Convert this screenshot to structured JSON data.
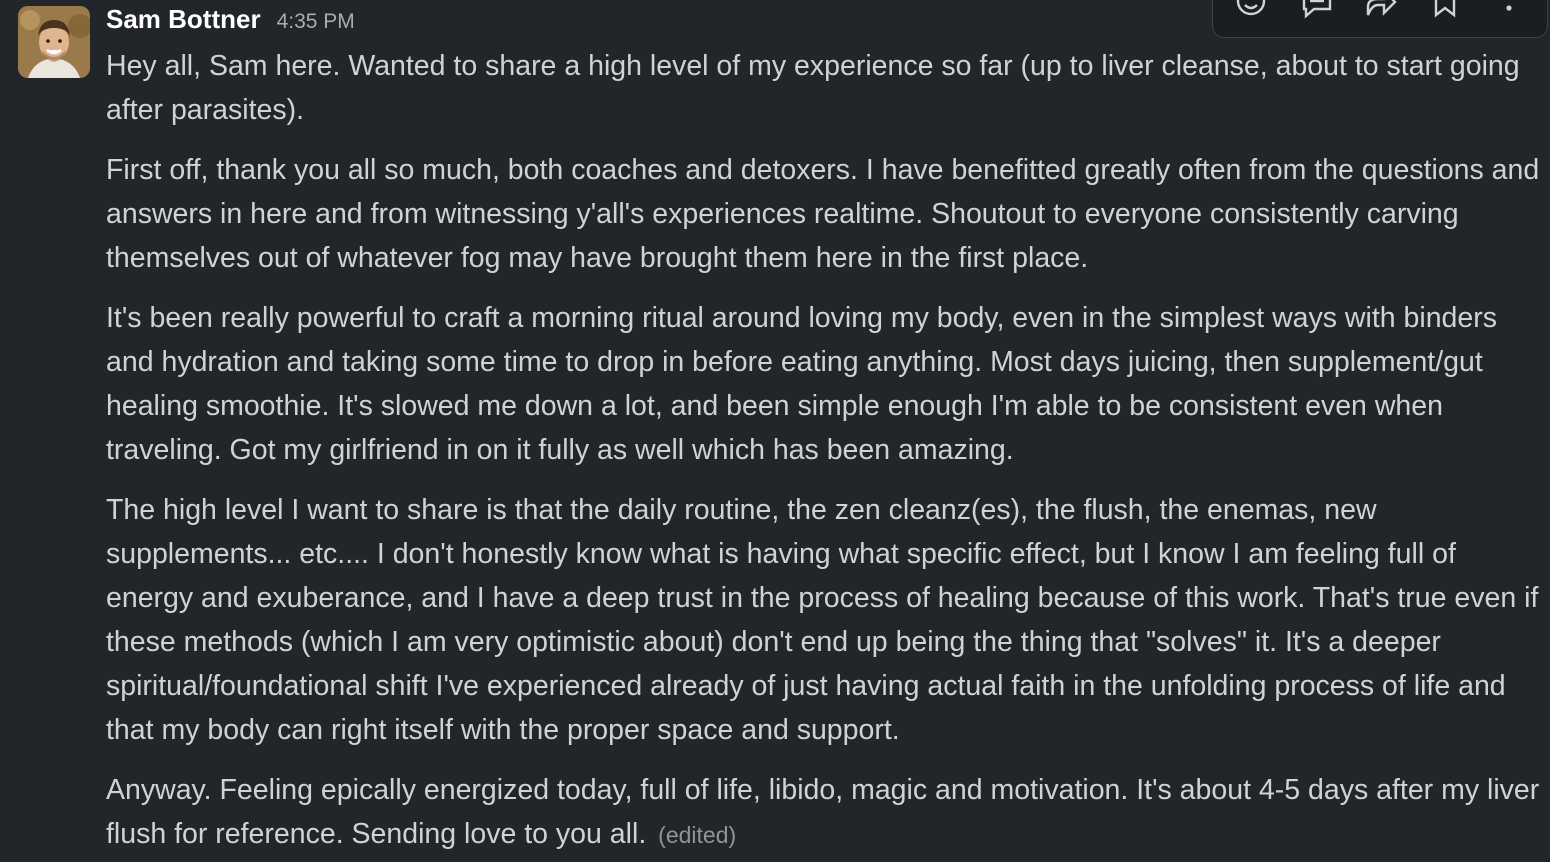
{
  "message": {
    "sender": "Sam Bottner",
    "timestamp": "4:35 PM",
    "paragraphs": [
      "Hey all, Sam here. Wanted to share a high level of my experience so far (up to liver cleanse, about to start going after parasites).",
      "First off, thank you all so much, both coaches and detoxers. I have benefitted greatly often from the questions and answers in here and from witnessing y'all's experiences realtime. Shoutout to everyone consistently carving themselves out of whatever fog may have brought them here in the first place.",
      "It's been really powerful to craft a morning ritual around loving my body, even in the simplest ways with binders and hydration and taking some time to drop in before eating anything. Most days juicing, then supplement/gut healing smoothie. It's slowed me down a lot, and been simple enough I'm able to be consistent even when traveling. Got my girlfriend in on it fully as well which has been amazing.",
      "The high level I want to share is that the daily routine, the zen cleanz(es), the flush, the enemas, new supplements... etc.... I don't honestly know what is having what specific effect, but I know I am feeling full of energy and exuberance, and I have a deep trust in the process of healing because of this work. That's true even if these methods (which I am very optimistic about) don't end up being the thing that \"solves\" it. It's a deeper spiritual/foundational shift I've experienced already of just having actual faith in the unfolding process of life and that my body can right itself with the proper space and support.",
      "Anyway. Feeling epically energized today, full of life, libido, magic and motivation. It's about 4-5 days after my liver flush for reference. Sending love to you all."
    ],
    "edited_label": "(edited)"
  },
  "actions_toolbar": {
    "icons": [
      "add-reaction-icon",
      "reply-in-thread-icon",
      "forward-icon",
      "save-bookmark-icon",
      "more-actions-icon"
    ]
  },
  "colors": {
    "background": "#222529",
    "text": "#d1d2d3",
    "sender": "#ffffff",
    "muted": "#ababad"
  }
}
